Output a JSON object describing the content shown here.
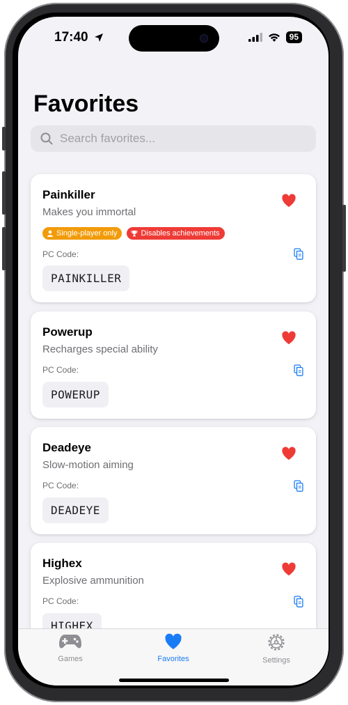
{
  "status": {
    "time": "17:40",
    "battery": "95"
  },
  "page": {
    "title": "Favorites"
  },
  "search": {
    "placeholder": "Search favorites..."
  },
  "cards": [
    {
      "name": "Painkiller",
      "description": "Makes you immortal",
      "badges": [
        "Single-player only",
        "Disables achievements"
      ],
      "code_label": "PC Code:",
      "code": "PAINKILLER",
      "favorited": true
    },
    {
      "name": "Powerup",
      "description": "Recharges special ability",
      "code_label": "PC Code:",
      "code": "POWERUP",
      "favorited": true
    },
    {
      "name": "Deadeye",
      "description": "Slow-motion aiming",
      "code_label": "PC Code:",
      "code": "DEADEYE",
      "favorited": true
    },
    {
      "name": "Highex",
      "description": "Explosive ammunition",
      "code_label": "PC Code:",
      "code": "HIGHEX",
      "favorited": true
    }
  ],
  "tabs": [
    {
      "label": "Games",
      "icon": "gamepad-icon",
      "active": false
    },
    {
      "label": "Favorites",
      "icon": "heart-icon",
      "active": true
    },
    {
      "label": "Settings",
      "icon": "gear-icon",
      "active": false
    }
  ],
  "colors": {
    "accent": "#1a7cf5",
    "heart": "#ef3b36",
    "badge_orange": "#f29b0a",
    "badge_red": "#ef3b36",
    "inactive_tab": "#8e8e93"
  }
}
